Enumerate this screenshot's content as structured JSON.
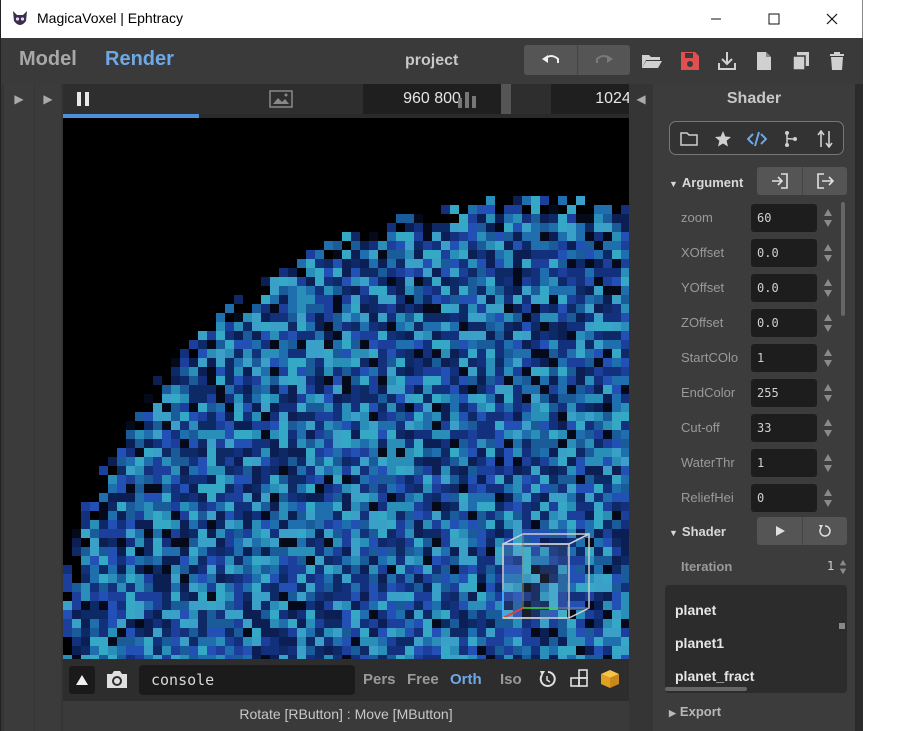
{
  "window": {
    "title": "MagicaVoxel | Ephtracy",
    "controls": {
      "minimize": "—",
      "maximize": "☐",
      "close": "✕"
    }
  },
  "toolbar": {
    "tabs": [
      {
        "label": "Model",
        "active": false
      },
      {
        "label": "Render",
        "active": true
      }
    ],
    "project_name": "project",
    "icons": [
      "undo-icon",
      "redo-icon",
      "open-folder-icon",
      "save-icon",
      "export-download-icon",
      "new-file-icon",
      "copy-file-icon",
      "delete-icon"
    ]
  },
  "render": {
    "size_value": "960  800",
    "sample_value": "1024",
    "progress_fraction": 0.24
  },
  "bottom": {
    "console_value": "console",
    "projection_modes": [
      {
        "label": "Pers",
        "active": false
      },
      {
        "label": "Free",
        "active": false
      },
      {
        "label": "Orth",
        "active": true
      },
      {
        "label": "Iso",
        "active": false
      }
    ],
    "status_hint": "Rotate [RButton] : Move [MButton]"
  },
  "panel": {
    "title": "Shader",
    "icon_tabs": [
      "folder-icon",
      "star-icon",
      "code-icon",
      "branch-icon",
      "sort-icon"
    ],
    "argument_section": "Argument",
    "arguments": [
      {
        "label": "zoom",
        "value": "60"
      },
      {
        "label": "XOffset",
        "value": "0.0"
      },
      {
        "label": "YOffset",
        "value": "0.0"
      },
      {
        "label": "ZOffset",
        "value": "0.0"
      },
      {
        "label": "StartCOlo",
        "value": "1"
      },
      {
        "label": "EndColor",
        "value": "255"
      },
      {
        "label": "Cut-off",
        "value": "33"
      },
      {
        "label": "WaterThr",
        "value": "1"
      },
      {
        "label": "ReliefHei",
        "value": "0"
      }
    ],
    "shader_section": "Shader",
    "iteration_label": "Iteration",
    "iteration_value": "1",
    "shader_files": [
      "planet",
      "planet1",
      "planet_fract"
    ],
    "export_section": "Export"
  },
  "colors": {
    "accent": "#4d8fd8",
    "active_tab": "#6fa8e6",
    "save_red": "#e05050",
    "voxel_dark": "#1b3f9a",
    "voxel_light": "#2a8fb8"
  }
}
